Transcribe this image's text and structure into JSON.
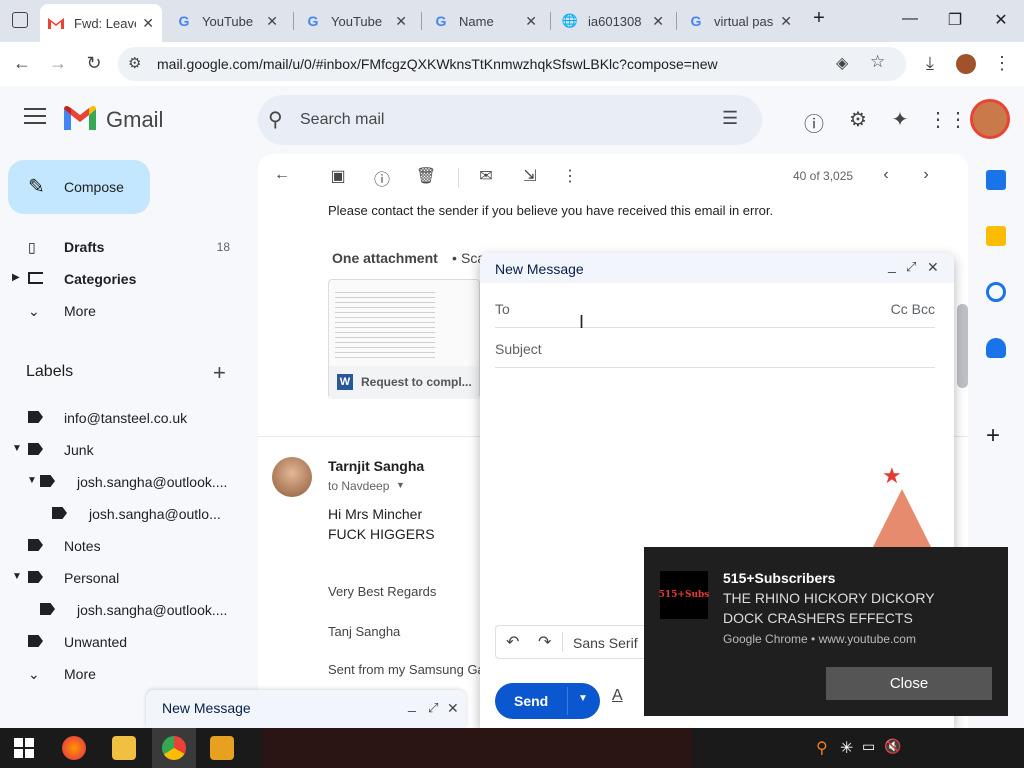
{
  "browser": {
    "tabs": [
      {
        "title": "Fwd: Leave",
        "favicon": "gmail-icon",
        "active": true
      },
      {
        "title": "YouTube",
        "favicon": "google-g-icon"
      },
      {
        "title": "YouTube",
        "favicon": "google-g-icon"
      },
      {
        "title": "Name",
        "favicon": "google-g-icon"
      },
      {
        "title": "ia601308",
        "favicon": "globe-icon"
      },
      {
        "title": "virtual pas",
        "favicon": "google-g-icon"
      }
    ],
    "url": "mail.google.com/mail/u/0/#inbox/FMfcgzQXKWknsTtKnmwzhqkSfswLBKlc?compose=new"
  },
  "gmail": {
    "logo_text": "Gmail",
    "search_placeholder": "Search mail",
    "compose_label": "Compose",
    "nav": [
      {
        "label": "Drafts",
        "count": "18",
        "icon": "draft-icon"
      },
      {
        "label": "Categories",
        "icon": "label-outline-icon",
        "bold": true
      },
      {
        "label": "More",
        "icon": "chevron-down-icon"
      }
    ],
    "labels_heading": "Labels",
    "labels": [
      {
        "label": "info@tansteel.co.uk",
        "indent": 0
      },
      {
        "label": "Junk",
        "indent": 0
      },
      {
        "label": "josh.sangha@outlook....",
        "indent": 1
      },
      {
        "label": "josh.sangha@outlo...",
        "indent": 2
      },
      {
        "label": "Notes",
        "indent": 0
      },
      {
        "label": "Personal",
        "indent": 0
      },
      {
        "label": "josh.sangha@outlook....",
        "indent": 1
      },
      {
        "label": "Unwanted",
        "indent": 0
      },
      {
        "label": "More",
        "indent": 0
      }
    ],
    "pagination": "40 of 3,025",
    "email": {
      "notice": "Please contact the sender if you believe you have received this email in error.",
      "attachment_heading": "One attachment",
      "attachment_scan": "Sca",
      "attachment_name": "Request to compl...",
      "sender": "Tarnjit Sangha",
      "to": "to Navdeep",
      "body_line1": "Hi Mrs Mincher",
      "body_line2": "FUCK HIGGERS",
      "regards": "Very Best Regards",
      "signature": "Tanj Sangha",
      "sent_from": "Sent from my Samsung Ga"
    },
    "compose": {
      "title": "New Message",
      "to_label": "To",
      "cc_bcc": "Cc Bcc",
      "subject_placeholder": "Subject",
      "font": "Sans Serif",
      "send": "Send"
    },
    "mini_compose_title": "New Message"
  },
  "notification": {
    "thumb_text": "515+Subs",
    "title": "515+Subscribers",
    "line1": "THE RHINO HICKORY DICKORY",
    "line2": "DOCK CRASHERS EFFECTS",
    "source": "Google Chrome • www.youtube.com",
    "close": "Close"
  },
  "colors": {
    "gmail_red": "#ea4335",
    "compose_bg": "#c2e7ff",
    "send_blue": "#0b57d0"
  }
}
